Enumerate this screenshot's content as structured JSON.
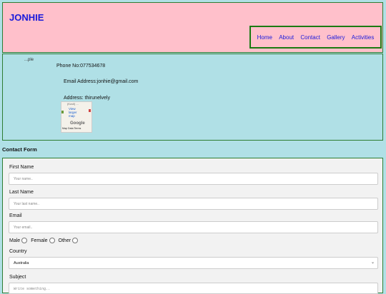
{
  "header": {
    "brand": "JONHIE",
    "nav": [
      "Home",
      "About",
      "Contact",
      "Gallery",
      "Activities"
    ]
  },
  "info": {
    "broken_image_alt": "...ple",
    "phone": "Phone No:077534678",
    "email": "Email Address:jonhie@gmail.com",
    "address": "Address: thirunelvely",
    "map": {
      "mini_text": "(Kovil) ...",
      "view_larger": "View larger map",
      "google": "Google",
      "footer": "Map Data  Terms"
    }
  },
  "form": {
    "title": "Contact Form",
    "first_name_label": "First Name",
    "first_name_placeholder": "Your name..",
    "last_name_label": "Last Name",
    "last_name_placeholder": "Your last name..",
    "email_label": "Email",
    "email_placeholder": "Your email..",
    "gender_options": [
      "Male",
      "Female",
      "Other"
    ],
    "country_label": "Country",
    "country_value": "Australia",
    "subject_label": "Subject",
    "subject_placeholder": "Write something.."
  },
  "colors": {
    "page_bg": "#b0e0e6",
    "header_bg": "#ffc0cb",
    "link": "#1a1adb",
    "border": "#2e7d32"
  }
}
